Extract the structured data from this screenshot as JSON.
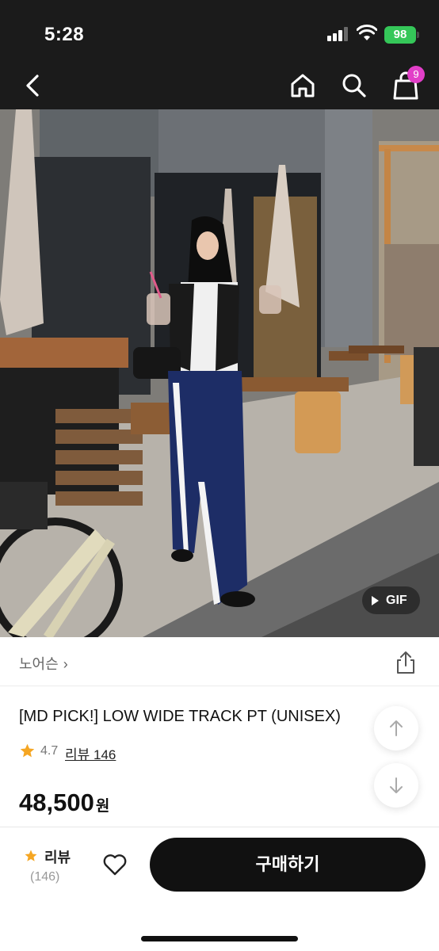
{
  "status_bar": {
    "time": "5:28",
    "battery": "98"
  },
  "nav": {
    "cart_badge": "9",
    "icons": [
      "back-arrow-icon",
      "home-icon",
      "search-icon",
      "shopping-bag-icon"
    ]
  },
  "media": {
    "gif_label": "GIF",
    "description_icon": "play-icon"
  },
  "brand": {
    "name": "노어슨",
    "chevron": "›"
  },
  "product": {
    "title": "[MD PICK!] LOW WIDE TRACK PT (UNISEX)",
    "rating": "4.7",
    "review_link": "리뷰 146",
    "price": "48,500",
    "price_unit": "원"
  },
  "bottom_bar": {
    "review_label": "리뷰",
    "review_count": "(146)",
    "buy_label": "구매하기"
  },
  "colors": {
    "header_bg": "#1b1b1b",
    "badge": "#e23fc8",
    "battery": "#35c759",
    "star": "#f5a623",
    "buy_button": "#111111"
  }
}
